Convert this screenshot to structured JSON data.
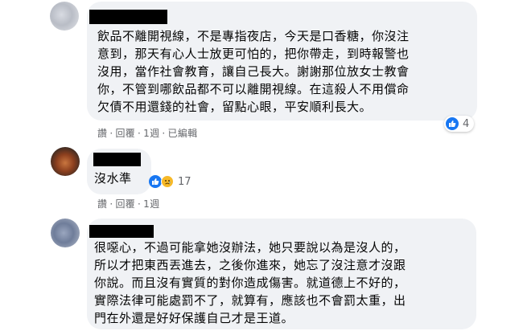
{
  "comments": [
    {
      "text": "飲品不離開視線，不是專指夜店，今天是口香糖，你沒注\n意到，那天有心人士放更可怕的，把你帶走，到時報警也\n沒用，當作社會教育，讓自己長大。謝謝那位放女士教會\n你，不管到哪飲品都不可以離開視線。在這殺人不用償命\n欠債不用還錢的社會，留點心眼，平安順利長大。",
      "actions": {
        "like": "讚",
        "reply": "回覆",
        "time": "1週",
        "edited": "已編輯"
      },
      "reactions": {
        "icons": [
          "like-icon"
        ],
        "count": "4"
      }
    },
    {
      "text": "沒水準",
      "actions": {
        "like": "讚",
        "reply": "回覆",
        "time": "1週"
      },
      "reactions": {
        "icons": [
          "like-icon",
          "sad-icon"
        ],
        "count": "17"
      }
    },
    {
      "text": "很噁心，不過可能拿她沒辦法，她只要說以為是沒人的，\n所以才把東西丟進去，之後你進來，她忘了沒注意才沒跟\n你說。而且沒有實質的對你造成傷害。就道德上不好的，\n實際法律可能處罰不了，就算有，應該也不會罰太重，出\n門在外還是好好保護自己才是王道。"
    }
  ],
  "colors": {
    "bubble": "#f0f2f5",
    "meta": "#65676b",
    "like": "#1877f2",
    "sad": "#f7b928"
  }
}
